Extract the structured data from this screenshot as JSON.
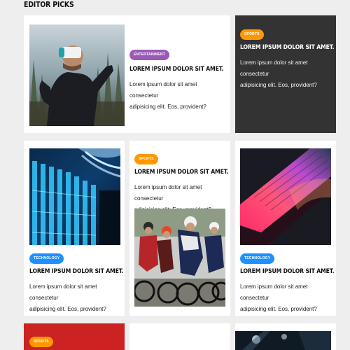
{
  "section": {
    "title": "EDITOR PICKS"
  },
  "lorem": {
    "headline": "LOREM IPSUM DOLOR SIT AMET.",
    "excerpt_line1": "Lorem ipsum dolor sit amet consectetur",
    "excerpt_line2": "adipisicing elit. Eos, provident?"
  },
  "cards": {
    "vr": {
      "category": "ENTERTAINMENT",
      "category_color": "#9b59b6"
    },
    "sports_dark": {
      "category": "SPORTS",
      "category_color": "#ff9800"
    },
    "servers": {
      "category": "TECHNOLOGY",
      "category_color": "#1e90ff"
    },
    "cycling": {
      "category": "SPORTS",
      "category_color": "#ff9800"
    },
    "laptop": {
      "category": "TECHNOLOGY",
      "category_color": "#1e90ff"
    },
    "red_bottom": {
      "category": "SPORTS",
      "category_color": "#ff9800"
    }
  }
}
